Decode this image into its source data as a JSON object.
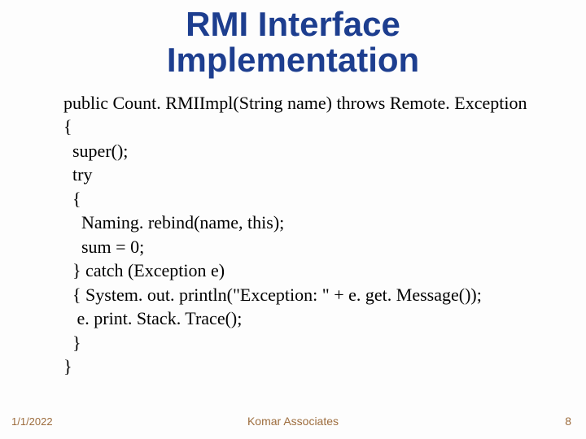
{
  "title_line1": "RMI Interface",
  "title_line2": "Implementation",
  "code": "public Count. RMIImpl(String name) throws Remote. Exception\n{\n  super();\n  try\n  {\n    Naming. rebind(name, this);\n    sum = 0;\n  } catch (Exception e)\n  { System. out. println(\"Exception: \" + e. get. Message());\n   e. print. Stack. Trace();\n  }\n}",
  "footer": {
    "date": "1/1/2022",
    "center": "Komar Associates",
    "page": "8"
  }
}
